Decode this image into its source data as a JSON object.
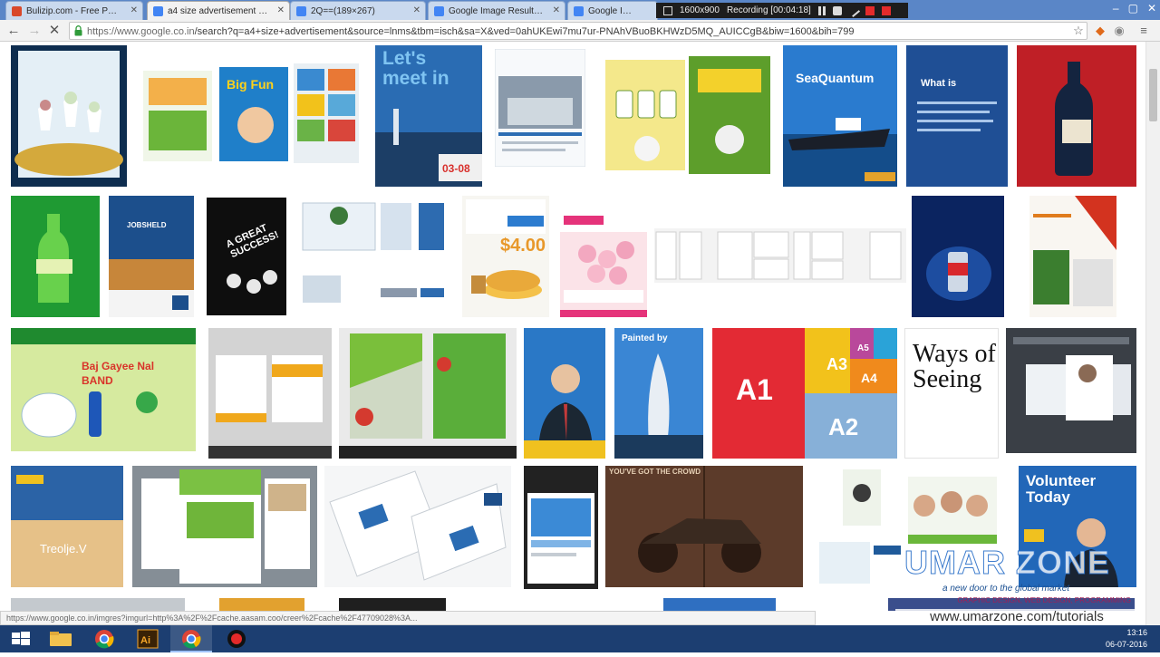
{
  "browser": {
    "tabs": [
      {
        "title": "Bulizip.com - Free PDF P...",
        "favicon_color": "#d9482a",
        "active": false
      },
      {
        "title": "a4 size advertisement - G...",
        "favicon_color": "#4285f4",
        "active": true
      },
      {
        "title": "2Q==(189×267)",
        "favicon_color": "#4285f4",
        "active": false
      },
      {
        "title": "Google Image Result for ...",
        "favicon_color": "#4285f4",
        "active": false
      },
      {
        "title": "Google Image Re...",
        "favicon_color": "#4285f4",
        "active": false
      }
    ],
    "recording": {
      "size": "1600x900",
      "status": "Recording [00:04:18]"
    },
    "url": {
      "scheme_host": "https://www.google.co.in",
      "path": "/search?q=a4+size+advertisement&source=lnms&tbm=isch&sa=X&ved=0ahUKEwi7mu7ur-PNAhVBuoBKHWzD5MQ_AUICCgB&biw=1600&bih=799"
    }
  },
  "images": [
    {
      "label": "",
      "bg": "#d9e8f2"
    },
    {
      "label": "",
      "bg": "#eaf3e2"
    },
    {
      "label": "Let's meet in",
      "bg": "#2a5c9e"
    },
    {
      "label": "",
      "bg": "#eef3f8"
    },
    {
      "label": "",
      "bg": "#f1e27a"
    },
    {
      "label": "SeaQuantum",
      "bg": "#1a5ea8"
    },
    {
      "label": "What is",
      "bg": "#1e4a8c"
    },
    {
      "label": "",
      "bg": "#b21e23"
    },
    {
      "label": "",
      "bg": "#1c8a2c"
    },
    {
      "label": "JOBSHELD",
      "bg": "#1a4b86"
    },
    {
      "label": "A GREAT SUCCESS!",
      "bg": "#111111"
    },
    {
      "label": "",
      "bg": "#e7eef4"
    },
    {
      "label": "$4.00",
      "bg": "#f4f4f0"
    },
    {
      "label": "",
      "bg": "#f8d9df"
    },
    {
      "label": "",
      "bg": "#f3f3f3"
    },
    {
      "label": "",
      "bg": "#0d2a6b"
    },
    {
      "label": "",
      "bg": "#f3f3f3"
    },
    {
      "label": "Baj Gayee Nal BAND",
      "bg": "#c8e39a"
    },
    {
      "label": "",
      "bg": "#dcdcdc"
    },
    {
      "label": "",
      "bg": "#eeeeee"
    },
    {
      "label": "",
      "bg": "#1f6dbc"
    },
    {
      "label": "Painted by",
      "bg": "#2b6fba"
    },
    {
      "label": "A1",
      "bg": "#e52a33"
    },
    {
      "label": "Ways of Seeing",
      "bg": "#ffffff"
    },
    {
      "label": "",
      "bg": "#2b2f36"
    },
    {
      "label": "Treolje.V",
      "bg": "#1b4e8c"
    },
    {
      "label": "",
      "bg": "#7f8a92"
    },
    {
      "label": "",
      "bg": "#f4f4f4"
    },
    {
      "label": "",
      "bg": "#1a1a1a"
    },
    {
      "label": "YOU'VE GOT THE CROWD",
      "bg": "#6b4530"
    },
    {
      "label": "",
      "bg": "#ffffff"
    },
    {
      "label": "Volunteer Today",
      "bg": "#1a4f9a"
    }
  ],
  "status_url": "https://www.google.co.in/imgres?imgurl=http%3A%2F%2Fcache.aasam.coo/creer%2Fcache%2F47709028%3A...",
  "watermark": {
    "title": "UMAR ZONE",
    "tagline": "a new door to the global market",
    "sub": "GRAPHIC DESIGN, WEB DESIGN, PROGRAMMING",
    "url": "www.umarzone.com/tutorials"
  },
  "taskbar": {
    "time": "13:16",
    "date": "06-07-2016"
  }
}
